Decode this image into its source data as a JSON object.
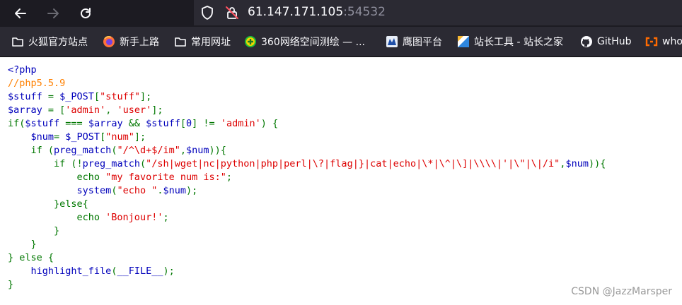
{
  "browser": {
    "url_host": "61.147.171.105",
    "url_port": ":54532"
  },
  "bookmarks": [
    {
      "label": "火狐官方站点",
      "icon": "folder-icon"
    },
    {
      "label": "新手上路",
      "icon": "firefox-icon"
    },
    {
      "label": "常用网址",
      "icon": "folder-icon"
    },
    {
      "label": "360网络空间测绘 — ...",
      "icon": "plus-globe-icon"
    },
    {
      "label": "鹰图平台",
      "icon": "eagle-icon"
    },
    {
      "label": "站长工具 - 站长之家",
      "icon": "chinaz-icon"
    },
    {
      "label": "GitHub",
      "icon": "github-icon"
    },
    {
      "label": "who",
      "icon": "aliyun-icon"
    }
  ],
  "code_lines": [
    [
      {
        "t": "<?php",
        "c": "var"
      }
    ],
    [
      {
        "t": "//php5.5.9",
        "c": "com"
      }
    ],
    [
      {
        "t": "$stuff ",
        "c": "var"
      },
      {
        "t": "= ",
        "c": "kw"
      },
      {
        "t": "$_POST",
        "c": "var"
      },
      {
        "t": "[",
        "c": "kw"
      },
      {
        "t": "\"stuff\"",
        "c": "str"
      },
      {
        "t": "];",
        "c": "kw"
      }
    ],
    [
      {
        "t": "$array ",
        "c": "var"
      },
      {
        "t": "= [",
        "c": "kw"
      },
      {
        "t": "'admin'",
        "c": "str"
      },
      {
        "t": ", ",
        "c": "kw"
      },
      {
        "t": "'user'",
        "c": "str"
      },
      {
        "t": "];",
        "c": "kw"
      }
    ],
    [
      {
        "t": "if(",
        "c": "kw"
      },
      {
        "t": "$stuff ",
        "c": "var"
      },
      {
        "t": "=== ",
        "c": "kw"
      },
      {
        "t": "$array ",
        "c": "var"
      },
      {
        "t": "&& ",
        "c": "kw"
      },
      {
        "t": "$stuff",
        "c": "var"
      },
      {
        "t": "[",
        "c": "kw"
      },
      {
        "t": "0",
        "c": "var"
      },
      {
        "t": "] != ",
        "c": "kw"
      },
      {
        "t": "'admin'",
        "c": "str"
      },
      {
        "t": ") {",
        "c": "kw"
      }
    ],
    [
      {
        "t": "    ",
        "c": "kw"
      },
      {
        "t": "$num",
        "c": "var"
      },
      {
        "t": "= ",
        "c": "kw"
      },
      {
        "t": "$_POST",
        "c": "var"
      },
      {
        "t": "[",
        "c": "kw"
      },
      {
        "t": "\"num\"",
        "c": "str"
      },
      {
        "t": "];",
        "c": "kw"
      }
    ],
    [
      {
        "t": "    if (",
        "c": "kw"
      },
      {
        "t": "preg_match",
        "c": "var"
      },
      {
        "t": "(",
        "c": "kw"
      },
      {
        "t": "\"/^\\d+$/im\"",
        "c": "str"
      },
      {
        "t": ",",
        "c": "kw"
      },
      {
        "t": "$num",
        "c": "var"
      },
      {
        "t": ")){",
        "c": "kw"
      }
    ],
    [
      {
        "t": "        if (!",
        "c": "kw"
      },
      {
        "t": "preg_match",
        "c": "var"
      },
      {
        "t": "(",
        "c": "kw"
      },
      {
        "t": "\"/sh|wget|nc|python|php|perl|\\?|flag|}|cat|echo|\\*|\\^|\\]|\\\\\\\\|'|\\\"|\\|/i\"",
        "c": "str"
      },
      {
        "t": ",",
        "c": "kw"
      },
      {
        "t": "$num",
        "c": "var"
      },
      {
        "t": ")){",
        "c": "kw"
      }
    ],
    [
      {
        "t": "            echo ",
        "c": "kw"
      },
      {
        "t": "\"my favorite num is:\"",
        "c": "str"
      },
      {
        "t": ";",
        "c": "kw"
      }
    ],
    [
      {
        "t": "            ",
        "c": "kw"
      },
      {
        "t": "system",
        "c": "var"
      },
      {
        "t": "(",
        "c": "kw"
      },
      {
        "t": "\"echo \"",
        "c": "str"
      },
      {
        "t": ".",
        "c": "kw"
      },
      {
        "t": "$num",
        "c": "var"
      },
      {
        "t": ");",
        "c": "kw"
      }
    ],
    [
      {
        "t": "        }else{",
        "c": "kw"
      }
    ],
    [
      {
        "t": "            echo ",
        "c": "kw"
      },
      {
        "t": "'Bonjour!'",
        "c": "str"
      },
      {
        "t": ";",
        "c": "kw"
      }
    ],
    [
      {
        "t": "        }",
        "c": "kw"
      }
    ],
    [
      {
        "t": "    }",
        "c": "kw"
      }
    ],
    [
      {
        "t": "} else {",
        "c": "kw"
      }
    ],
    [
      {
        "t": "    ",
        "c": "kw"
      },
      {
        "t": "highlight_file",
        "c": "var"
      },
      {
        "t": "(",
        "c": "kw"
      },
      {
        "t": "__FILE__",
        "c": "var"
      },
      {
        "t": ");",
        "c": "kw"
      }
    ],
    [
      {
        "t": "}",
        "c": "kw"
      }
    ]
  ],
  "watermark": "CSDN @JazzMarsper"
}
